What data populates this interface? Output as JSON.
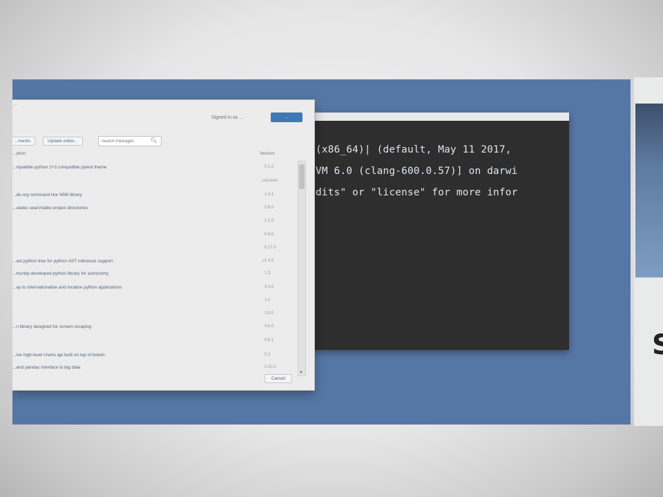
{
  "terminal": {
    "lines": [
      "(x86_64)| (default, May 11 2017,",
      "VM 6.0 (clang-600.0.57)] on darwi",
      "dits\" or \"license\" for more infor"
    ]
  },
  "dialog": {
    "title": "...",
    "signed_in": "Signed in as ...",
    "sign_in_button": "...",
    "buttons": {
      "left": "...ments",
      "update": "Update index...",
      "cancel": "Cancel"
    },
    "search": {
      "placeholder": "Search Packages"
    },
    "columns": {
      "name": "...ption",
      "version": "Version"
    },
    "rows": [
      {
        "desc": "...mpatible python 2+3 compatible pytest theme",
        "version": "0.1.0"
      },
      {
        "desc": "",
        "version": "custom",
        "mark": "✓"
      },
      {
        "desc": "...de.org command line WMI library",
        "version": "1.4.1"
      },
      {
        "desc": "...ulates searchable project directories",
        "version": "0.8.0"
      },
      {
        "desc": "",
        "version": "1.1.0"
      },
      {
        "desc": "",
        "version": "0.6.5"
      },
      {
        "desc": "",
        "version": "0.17.0"
      },
      {
        "desc": "...ast python tree for python AST inference support",
        "version": "1.4.5",
        "mark": "✓"
      },
      {
        "desc": "...munity-developed python library for astronomy",
        "version": "1.3"
      },
      {
        "desc": "...ay to internationalize and localize python applications",
        "version": "2.4.0"
      },
      {
        "desc": "",
        "version": "1.0"
      },
      {
        "desc": "",
        "version": "2.0.0"
      },
      {
        "desc": "...n library designed for screen-scraping",
        "version": "4.6.0"
      },
      {
        "desc": "",
        "version": "0.6.1"
      },
      {
        "desc": "...ive high-level charts api built on top of bokeh",
        "version": "0.2"
      },
      {
        "desc": "...and pandas interface to big data",
        "version": "0.10.1"
      }
    ]
  },
  "side": {
    "glyph": "S"
  }
}
